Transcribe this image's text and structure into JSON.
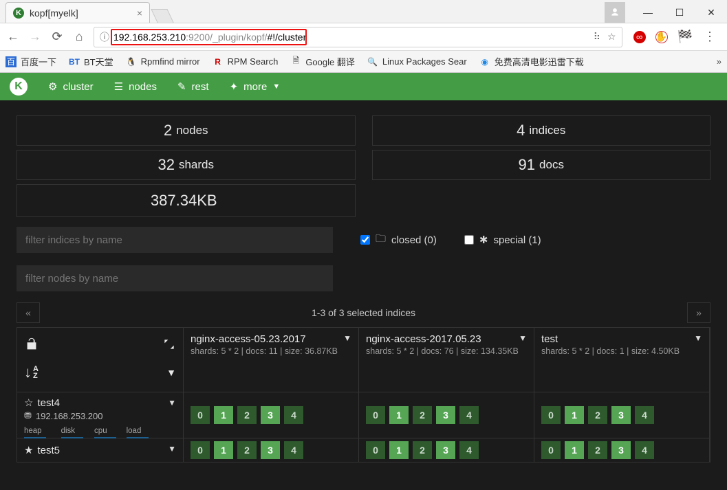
{
  "browser": {
    "tab_title": "kopf[myelk]",
    "url_host": "192.168.253.210",
    "url_port_path": ":9200/_plugin/kopf/",
    "url_hash": "#!/cluster",
    "bookmarks": [
      "百度一下",
      "BT天堂",
      "Rpmfind mirror",
      "RPM Search",
      "Google 翻译",
      "Linux Packages Sear",
      "免费高清电影迅雷下载"
    ]
  },
  "nav": {
    "cluster": "cluster",
    "nodes": "nodes",
    "rest": "rest",
    "more": "more"
  },
  "stats": {
    "nodes_n": "2",
    "nodes_l": "nodes",
    "shards_n": "32",
    "shards_l": "shards",
    "size": "387.34KB",
    "indices_n": "4",
    "indices_l": "indices",
    "docs_n": "91",
    "docs_l": "docs"
  },
  "filters": {
    "indices_ph": "filter indices by name",
    "nodes_ph": "filter nodes by name",
    "closed_label": "closed (0)",
    "special_label": "special (1)"
  },
  "ribbon": {
    "text": "1-3 of 3 selected indices"
  },
  "indices": [
    {
      "name": "nginx-access-05.23.2017",
      "sub": "shards: 5 * 2 | docs: 11 | size: 36.87KB"
    },
    {
      "name": "nginx-access-2017.05.23",
      "sub": "shards: 5 * 2 | docs: 76 | size: 134.35KB"
    },
    {
      "name": "test",
      "sub": "shards: 5 * 2 | docs: 1 | size: 4.50KB"
    }
  ],
  "nodes": [
    {
      "name": "test4",
      "ip": "192.168.253.200",
      "metrics": [
        "heap",
        "disk",
        "cpu",
        "load"
      ],
      "shards": [
        "0",
        "1",
        "2",
        "3",
        "4"
      ]
    },
    {
      "name": "test5"
    }
  ],
  "bright_shards": [
    "1",
    "3"
  ]
}
